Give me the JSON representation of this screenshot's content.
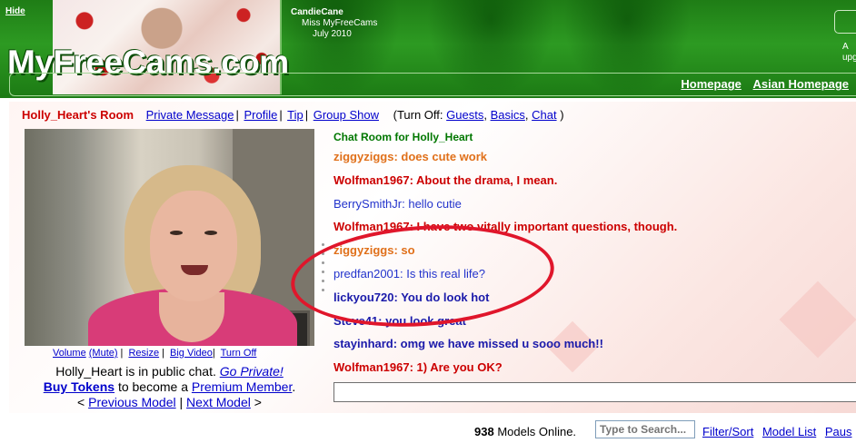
{
  "header": {
    "hide_label": "Hide",
    "logo_text": "MyFreeCams.com",
    "featured_model": "CandieCane",
    "featured_title": "Miss MyFreeCams",
    "featured_date": "July 2010",
    "login_text_1": "A",
    "login_text_2": "upg",
    "nav": [
      "Homepage",
      "Asian Homepage"
    ]
  },
  "room_bar": {
    "room_title": "Holly_Heart's Room",
    "links": [
      "Private Message",
      "Profile",
      "Tip",
      "Group Show"
    ],
    "turn_off_prefix": "(Turn Off:",
    "turn_off_links": [
      "Guests",
      "Basics",
      "Chat"
    ],
    "turn_off_suffix": ")"
  },
  "video_controls": {
    "volume": "Volume",
    "mute": "(Mute)",
    "resize": "Resize",
    "big_video": "Big Video",
    "turn_off": "Turn Off"
  },
  "status": {
    "line1_text": "Holly_Heart is in public chat.",
    "line1_link": "Go Private!",
    "line2_link1": "Buy Tokens",
    "line2_text": "to become a",
    "line2_link2": "Premium Member",
    "line2_end": ".",
    "line3_left": "<",
    "line3_prev": "Previous Model",
    "line3_sep": "|",
    "line3_next": "Next Model",
    "line3_right": ">"
  },
  "chat": {
    "title": "Chat Room for Holly_Heart",
    "messages": [
      {
        "text": "ziggyziggs: does cute work",
        "color": "#e0701a",
        "bold": true
      },
      {
        "text": "Wolfman1967: About the drama, I mean.",
        "color": "#cc0000",
        "bold": true
      },
      {
        "text": "BerrySmithJr: hello cutie",
        "color": "#2233cc",
        "bold": false
      },
      {
        "text": "Wolfman1967: I have two vitally important questions, though.",
        "color": "#cc0000",
        "bold": true
      },
      {
        "text": "ziggyziggs: so",
        "color": "#e0701a",
        "bold": true
      },
      {
        "text": "predfan2001: Is this real life?",
        "color": "#2233cc",
        "bold": false
      },
      {
        "text": "lickyou720: You do look hot",
        "color": "#1a1aaa",
        "bold": true
      },
      {
        "text": "Steve41: you look great",
        "color": "#1a1aaa",
        "bold": true
      },
      {
        "text": "stayinhard: omg we have missed u sooo much!!",
        "color": "#1a1aaa",
        "bold": true
      },
      {
        "text": "Wolfman1967: 1) Are you OK?",
        "color": "#cc0000",
        "bold": true
      }
    ],
    "input_value": ""
  },
  "footer": {
    "models_online_count": "938",
    "models_online_label": "Models Online.",
    "search_placeholder": "Type to Search...",
    "links": [
      "Filter/Sort",
      "Model List",
      "Paus"
    ]
  }
}
